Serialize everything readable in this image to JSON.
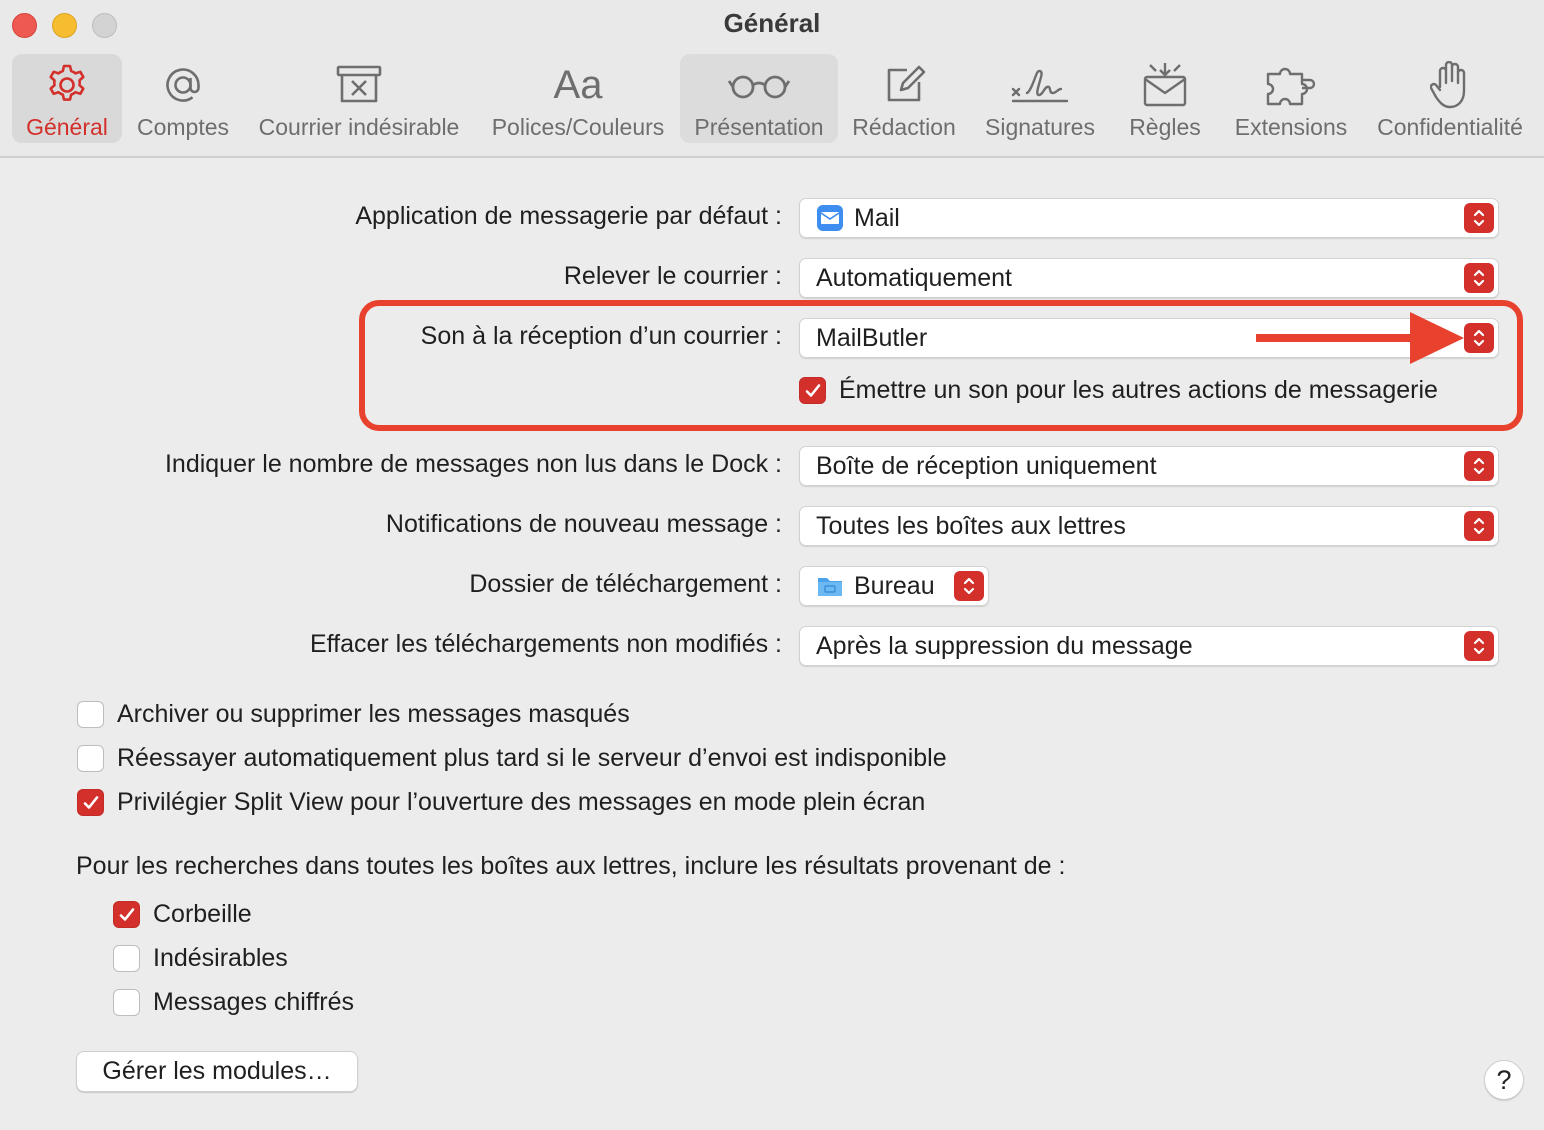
{
  "window": {
    "title": "Général"
  },
  "toolbar": {
    "tabs": [
      {
        "label": "Général",
        "icon": "gear-icon"
      },
      {
        "label": "Comptes",
        "icon": "at-icon"
      },
      {
        "label": "Courrier indésirable",
        "icon": "junk-icon"
      },
      {
        "label": "Polices/Couleurs",
        "icon": "fonts-icon",
        "glyph": "Aa"
      },
      {
        "label": "Présentation",
        "icon": "glasses-icon"
      },
      {
        "label": "Rédaction",
        "icon": "compose-icon"
      },
      {
        "label": "Signatures",
        "icon": "signature-icon"
      },
      {
        "label": "Règles",
        "icon": "rules-icon"
      },
      {
        "label": "Extensions",
        "icon": "puzzle-icon"
      },
      {
        "label": "Confidentialité",
        "icon": "hand-icon"
      }
    ],
    "selected": "Général"
  },
  "settings": {
    "default_app": {
      "label": "Application de messagerie par défaut :",
      "value": "Mail",
      "icon": "mail-app-icon"
    },
    "check_mail": {
      "label": "Relever le courrier :",
      "value": "Automatiquement"
    },
    "new_mail_sound": {
      "label": "Son à la réception d’un courrier :",
      "value": "MailButler"
    },
    "other_sounds": {
      "label": "Émettre un son pour les autres actions de messagerie",
      "checked": true
    },
    "dock_unread": {
      "label": "Indiquer le nombre de messages non lus dans le Dock :",
      "value": "Boîte de réception uniquement"
    },
    "notifications": {
      "label": "Notifications de nouveau message :",
      "value": "Toutes les boîtes aux lettres"
    },
    "download_folder": {
      "label": "Dossier de téléchargement :",
      "value": "Bureau",
      "icon": "folder-icon"
    },
    "remove_downloads": {
      "label": "Effacer les téléchargements non modifiés :",
      "value": "Après la suppression du message"
    }
  },
  "options": [
    {
      "label": "Archiver ou supprimer les messages masqués",
      "checked": false
    },
    {
      "label": "Réessayer automatiquement plus tard si le serveur d’envoi est indisponible",
      "checked": false
    },
    {
      "label": "Privilégier Split View pour l’ouverture des messages en mode plein écran",
      "checked": true
    }
  ],
  "search": {
    "heading": "Pour les recherches dans toutes les boîtes aux lettres, inclure les résultats provenant de :",
    "items": [
      {
        "label": "Corbeille",
        "checked": true
      },
      {
        "label": "Indésirables",
        "checked": false
      },
      {
        "label": "Messages chiffrés",
        "checked": false
      }
    ]
  },
  "buttons": {
    "manage_plugins": "Gérer les modules…",
    "help": "?"
  },
  "colors": {
    "accent": "#d3302b",
    "annotation": "#e8422e"
  }
}
